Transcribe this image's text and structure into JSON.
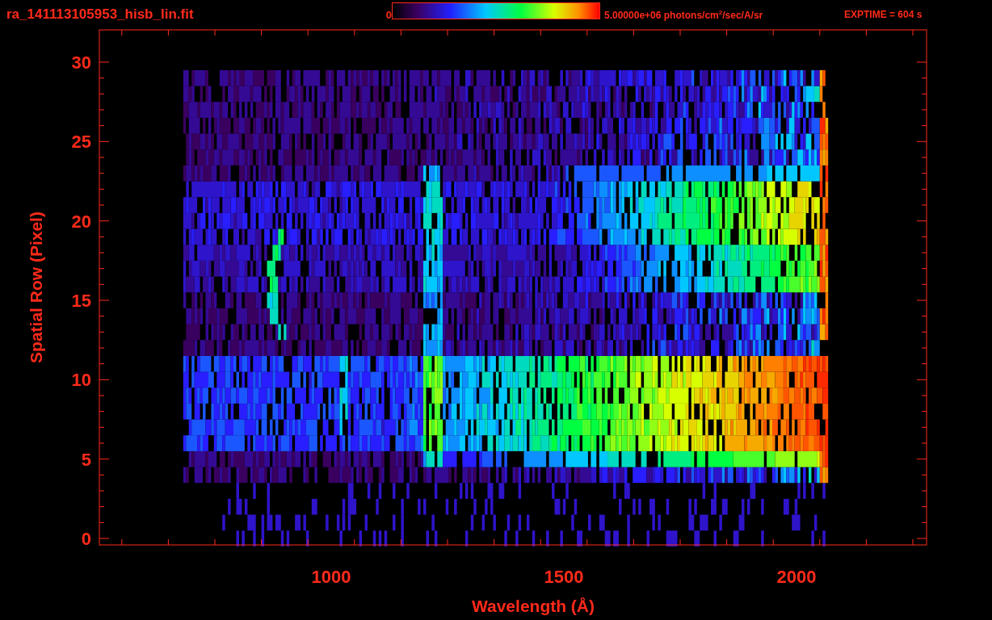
{
  "title": "ra_141113105953_hisb_lin.fit",
  "colorbar": {
    "min_label": "0",
    "max_label": "5.00000e+06 photons/cm$^{2}$/sec/A/sr",
    "exptime": "EXPTIME = 604 s"
  },
  "y_axis": {
    "label": "Spatial Row (Pixel)",
    "ticks": [
      "30",
      "25",
      "20",
      "15",
      "10",
      "5",
      "0"
    ]
  },
  "x_axis": {
    "label": "Wavelength (Å)",
    "ticks": [
      "1000",
      "1500",
      "2000"
    ]
  }
}
